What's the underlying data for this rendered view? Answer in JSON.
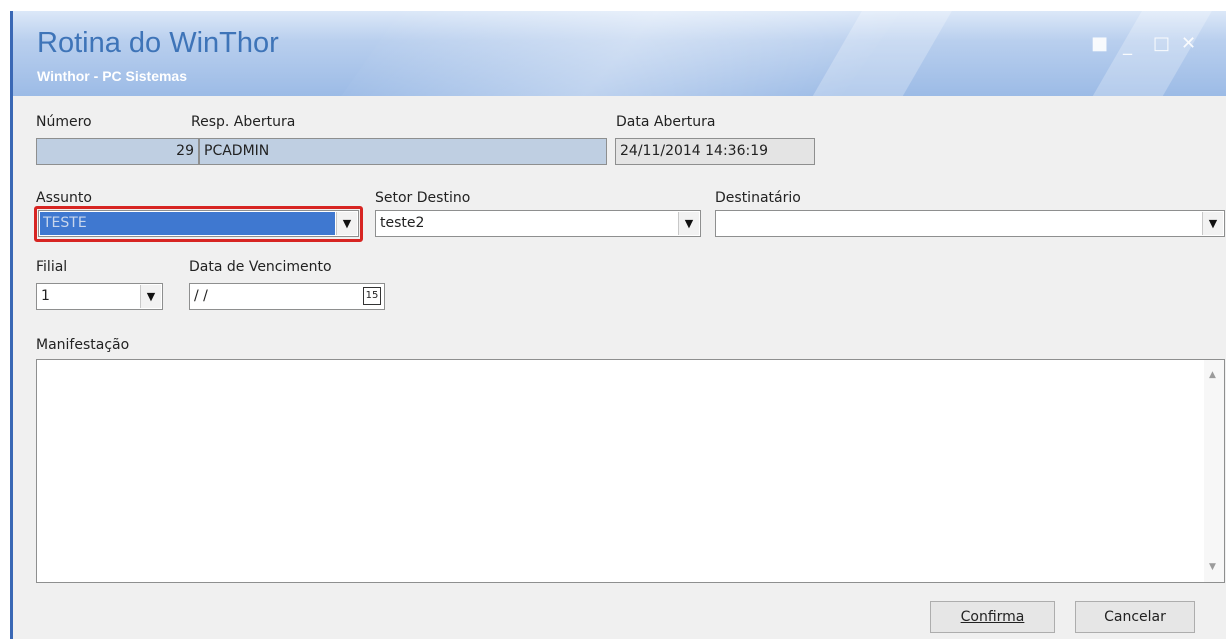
{
  "window": {
    "title": "Rotina do WinThor",
    "subtitle": "Winthor - PC Sistemas"
  },
  "form": {
    "numero": {
      "label": "Número",
      "value": "29"
    },
    "resp_abertura": {
      "label": "Resp. Abertura",
      "value": "PCADMIN"
    },
    "data_abertura": {
      "label": "Data Abertura",
      "value": "24/11/2014 14:36:19"
    },
    "assunto": {
      "label": "Assunto",
      "value": "TESTE"
    },
    "setor_destino": {
      "label": "Setor Destino",
      "value": "teste2"
    },
    "destinatario": {
      "label": "Destinatário",
      "value": ""
    },
    "filial": {
      "label": "Filial",
      "value": "1"
    },
    "data_vencimento": {
      "label": "Data de Vencimento",
      "value": " / /",
      "calendar_glyph": "15"
    },
    "manifestacao": {
      "label": "Manifestação",
      "value": ""
    }
  },
  "buttons": {
    "confirma": "Confirma",
    "cancelar": "Cancelar"
  },
  "colors": {
    "highlight": "#d72522",
    "title": "#3e74b8"
  }
}
